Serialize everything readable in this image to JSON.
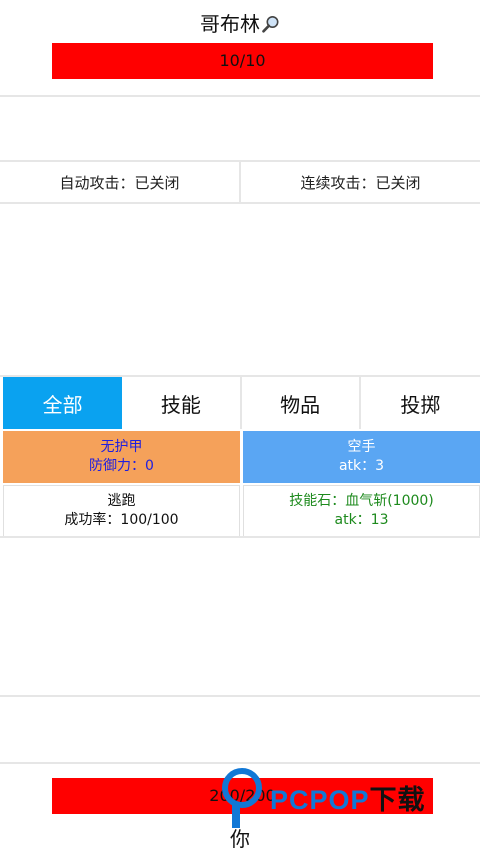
{
  "enemy": {
    "name": "哥布林",
    "hp_text": "10/10",
    "hp_fraction": 1.0,
    "bar_color": "#ff0000"
  },
  "toggles": {
    "auto_attack": "自动攻击：已关闭",
    "continuous_attack": "连续攻击：已关闭"
  },
  "tabs": [
    {
      "label": "全部",
      "active": true
    },
    {
      "label": "技能",
      "active": false
    },
    {
      "label": "物品",
      "active": false
    },
    {
      "label": "投掷",
      "active": false
    }
  ],
  "actions": {
    "armor": {
      "line1": "无护甲",
      "line2": "防御力：0"
    },
    "weapon": {
      "line1": "空手",
      "line2": "atk：3"
    },
    "flee": {
      "line1": "逃跑",
      "line2": "成功率：100/100"
    },
    "skill_stone": {
      "line1": "技能石：血气斩(1000)",
      "line2": "atk：13"
    }
  },
  "player": {
    "hp_text": "200/200",
    "hp_fraction": 1.0,
    "name": "你"
  },
  "watermark": {
    "brand": "PCPOP",
    "suffix": "下载"
  },
  "colors": {
    "tab_active": "#0aa2f0",
    "armor_card": "#f5a15a",
    "weapon_card": "#5aa6f3",
    "skill_text": "#1d8a1d",
    "armor_text": "#1f1fe0"
  }
}
